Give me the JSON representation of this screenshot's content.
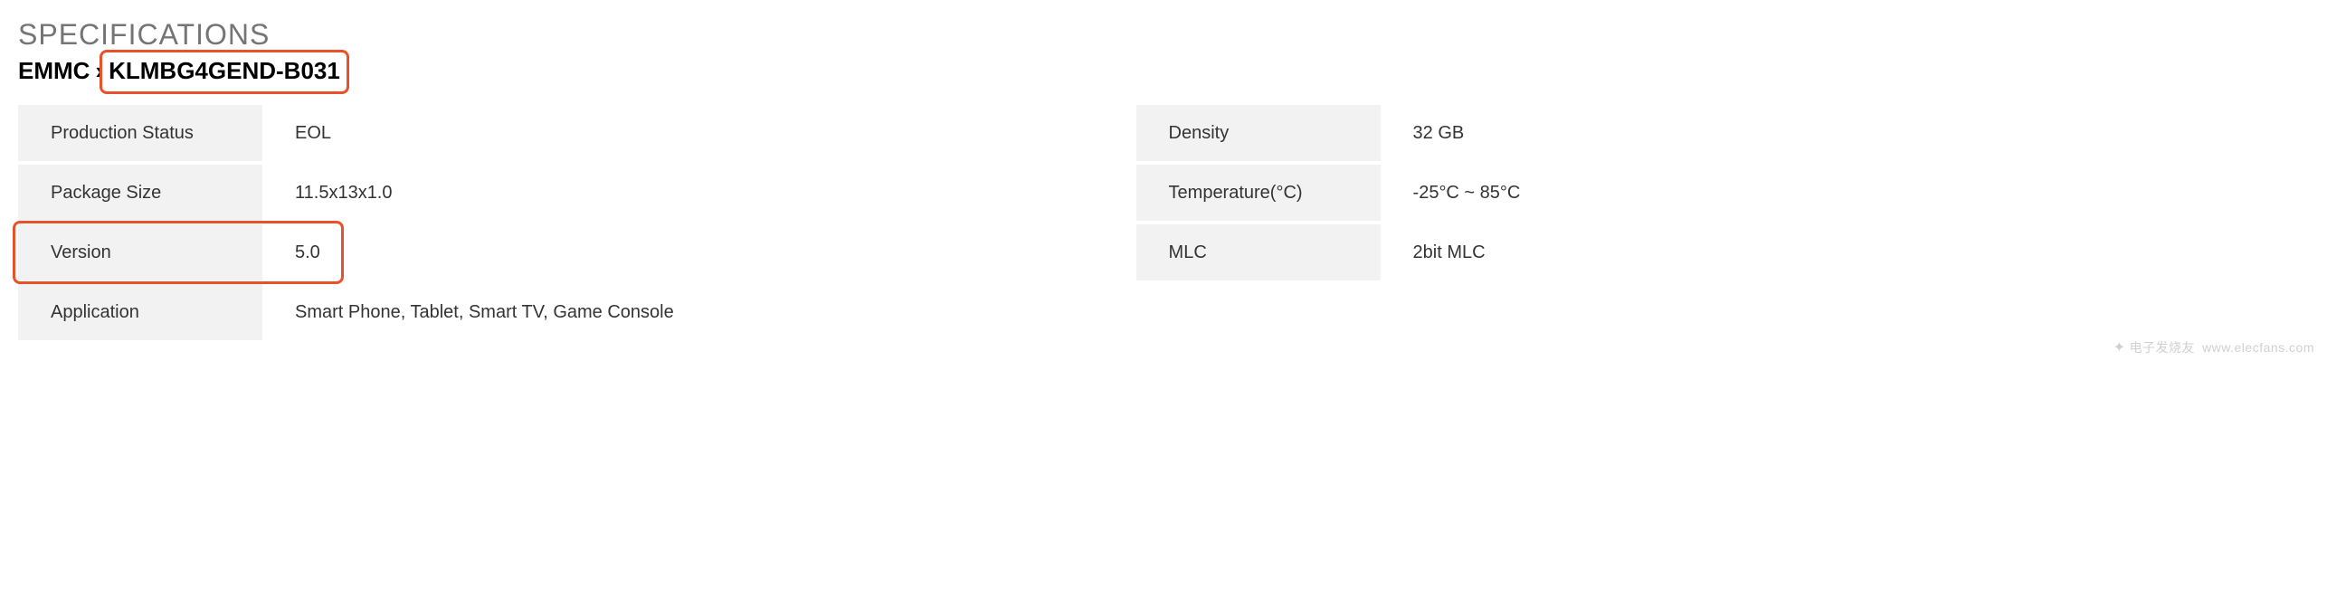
{
  "heading": "SPECIFICATIONS",
  "breadcrumb": {
    "category": "EMMC",
    "separator": "›",
    "product": "KLMBG4GEND-B031"
  },
  "specs": [
    {
      "label1": "Production Status",
      "value1": "EOL",
      "label2": "Density",
      "value2": "32 GB"
    },
    {
      "label1": "Package Size",
      "value1": "11.5x13x1.0",
      "label2": "Temperature(°C)",
      "value2": "-25°C ~ 85°C"
    },
    {
      "label1": "Version",
      "value1": "5.0",
      "label2": "MLC",
      "value2": "2bit MLC"
    },
    {
      "label1": "Application",
      "value1": "Smart Phone, Tablet, Smart TV, Game Console",
      "label2": "",
      "value2": ""
    }
  ],
  "watermark": {
    "icon_text": "✦",
    "text": "电子发烧友",
    "url": "www.elecfans.com"
  },
  "highlights": [
    "breadcrumb.product",
    "specs.2.version_row"
  ]
}
